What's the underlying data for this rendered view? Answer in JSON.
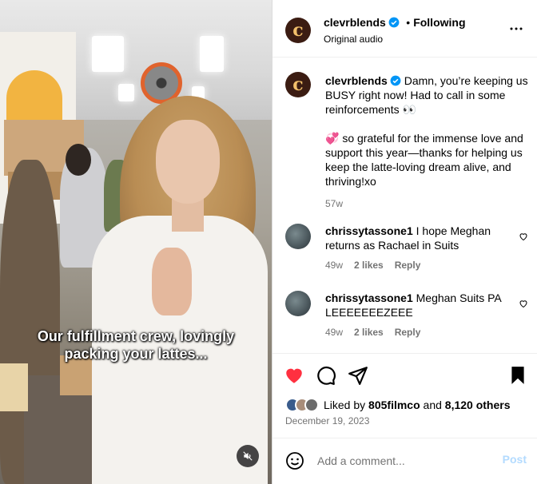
{
  "video": {
    "caption_line1": "Our fulfillment crew, lovingly",
    "caption_line2": "packing your lattes...",
    "mute_icon": "speaker-muted-icon"
  },
  "header": {
    "avatar_letter": "c",
    "username": "clevrblends",
    "separator": "•",
    "follow_status": "Following",
    "audio": "Original audio",
    "more_icon": "more-horizontal-icon"
  },
  "post_caption": {
    "username": "clevrblends",
    "paragraph1": "Damn, you’re keeping us BUSY right now! Had to call in some reinforcements 👀",
    "paragraph2": "💞 so grateful for the immense love and support this year—thanks for helping us keep the latte-loving dream alive, and thriving!xo",
    "time": "57w"
  },
  "comments": [
    {
      "username": "chrissytassone1",
      "text": "I hope Meghan returns as Rachael in Suits",
      "time": "49w",
      "likes": "2 likes",
      "reply": "Reply"
    },
    {
      "username": "chrissytassone1",
      "text": "Meghan Suits PA LEEEEEEEZEEE",
      "time": "49w",
      "likes": "2 likes",
      "reply": "Reply"
    }
  ],
  "actions": {
    "icons": [
      "heart-filled-icon",
      "comment-icon",
      "share-icon",
      "bookmark-icon"
    ],
    "like_color": "#ff3040"
  },
  "likes": {
    "prefix": "Liked by",
    "user": "805filmco",
    "and": "and",
    "others": "8,120 others"
  },
  "date": "December 19, 2023",
  "add_comment": {
    "placeholder": "Add a comment...",
    "post_label": "Post"
  },
  "colors": {
    "verified": "#0095f6",
    "secondary_text": "#737373",
    "post_disabled": "#b3dbff",
    "brand_avatar_bg": "#3b1c12",
    "brand_avatar_fg": "#f3c06b"
  }
}
